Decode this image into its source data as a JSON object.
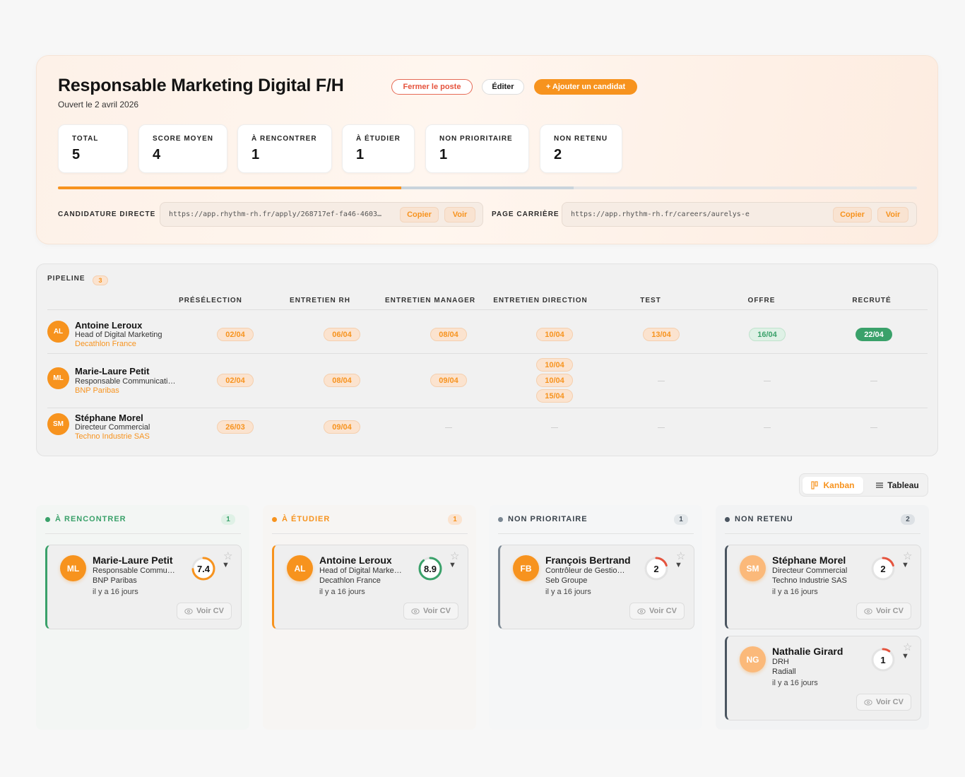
{
  "header": {
    "title": "Responsable Marketing Digital F/H",
    "opened": "Ouvert le 2 avril 2026",
    "close_label": "Fermer le poste",
    "edit_label": "Éditer",
    "add_label": "+ Ajouter un candidat"
  },
  "stats": [
    {
      "label": "TOTAL",
      "value": "5"
    },
    {
      "label": "SCORE MOYEN",
      "value": "4"
    },
    {
      "label": "À RENCONTRER",
      "value": "1"
    },
    {
      "label": "À ÉTUDIER",
      "value": "1"
    },
    {
      "label": "NON PRIORITAIRE",
      "value": "1"
    },
    {
      "label": "NON RETENU",
      "value": "2"
    }
  ],
  "progress": {
    "primary_fraction": 0.4,
    "secondary_fraction": 0.6
  },
  "links": {
    "direct_label": "CANDIDATURE DIRECTE",
    "direct_url": "https://app.rhythm-rh.fr/apply/268717ef-fa46-4603…",
    "career_label": "PAGE CARRIÈRE",
    "career_url": "https://app.rhythm-rh.fr/careers/aurelys-e",
    "copy_label": "Copier",
    "view_label": "Voir"
  },
  "pipeline": {
    "title": "PIPELINE",
    "count": "3",
    "stages": [
      "PRÉSÉLECTION",
      "ENTRETIEN RH",
      "ENTRETIEN MANAGER",
      "ENTRETIEN DIRECTION",
      "TEST",
      "OFFRE",
      "RECRUTÉ"
    ],
    "rows": [
      {
        "initials": "AL",
        "name": "Antoine Leroux",
        "role": "Head of Digital Marketing",
        "company": "Decathlon France",
        "cells": [
          [
            "02/04"
          ],
          [
            "06/04"
          ],
          [
            "08/04"
          ],
          [
            "10/04"
          ],
          [
            "13/04"
          ],
          [
            "16/04"
          ],
          [
            "22/04"
          ]
        ]
      },
      {
        "initials": "ML",
        "name": "Marie-Laure Petit",
        "role": "Responsable Communicati…",
        "company": "BNP Paribas",
        "cells": [
          [
            "02/04"
          ],
          [
            "08/04"
          ],
          [
            "09/04"
          ],
          [
            "10/04",
            "10/04",
            "15/04"
          ],
          [],
          [],
          []
        ]
      },
      {
        "initials": "SM",
        "name": "Stéphane Morel",
        "role": "Directeur Commercial",
        "company": "Techno Industrie SAS",
        "cells": [
          [
            "26/03"
          ],
          [
            "09/04"
          ],
          [],
          [],
          [],
          [],
          []
        ]
      }
    ]
  },
  "view_toggle": {
    "kanban": "Kanban",
    "table": "Tableau"
  },
  "kanban": {
    "columns": [
      {
        "title": "À RENCONTRER",
        "count": "1",
        "color": "#3aa16a",
        "cards": [
          {
            "initials": "ML",
            "name": "Marie-Laure Petit",
            "role": "Responsable Commu…",
            "company": "BNP Paribas",
            "ago": "il y a 16 jours",
            "score": "7.4",
            "score_fraction": 0.74,
            "score_color": "#f7931e"
          }
        ]
      },
      {
        "title": "À ÉTUDIER",
        "count": "1",
        "color": "#f7931e",
        "cards": [
          {
            "initials": "AL",
            "name": "Antoine Leroux",
            "role": "Head of Digital Marke…",
            "company": "Decathlon France",
            "ago": "il y a 16 jours",
            "score": "8.9",
            "score_fraction": 0.89,
            "score_color": "#3aa16a"
          }
        ]
      },
      {
        "title": "NON PRIORITAIRE",
        "count": "1",
        "color": "#7a8793",
        "cards": [
          {
            "initials": "FB",
            "name": "François Bertrand",
            "role": "Contrôleur de Gestio…",
            "company": "Seb Groupe",
            "ago": "il y a 16 jours",
            "score": "2",
            "score_fraction": 0.2,
            "score_color": "#e5533d"
          }
        ]
      },
      {
        "title": "NON RETENU",
        "count": "2",
        "color": "#4a5560",
        "cards": [
          {
            "initials": "SM",
            "name": "Stéphane Morel",
            "role": "Directeur Commercial",
            "company": "Techno Industrie SAS",
            "ago": "il y a 16 jours",
            "score": "2",
            "score_fraction": 0.2,
            "score_color": "#e5533d"
          },
          {
            "initials": "NG",
            "name": "Nathalie Girard",
            "role": "DRH",
            "company": "Radiall",
            "ago": "il y a 16 jours",
            "score": "1",
            "score_fraction": 0.1,
            "score_color": "#e5533d"
          }
        ]
      }
    ],
    "cv_label": "Voir CV"
  }
}
